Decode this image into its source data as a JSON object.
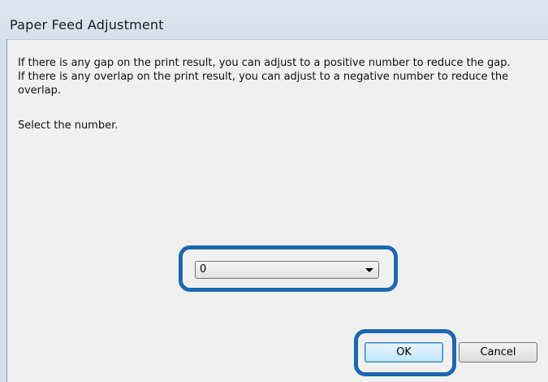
{
  "window": {
    "title": "Paper Feed Adjustment"
  },
  "dialog": {
    "message_line1": "If there is any gap on the print result, you can adjust to a positive number to reduce the gap.",
    "message_line2": "If there is any overlap on the print result, you can adjust to a negative number to reduce the overlap.",
    "prompt": "Select the number.",
    "adjustment_select": {
      "selected_value": "0"
    },
    "ok_label": "OK",
    "cancel_label": "Cancel"
  },
  "colors": {
    "highlight": "#1b67b3",
    "title_bar": "#d4e0ec"
  },
  "icons": {
    "dropdown": "chevron-down-icon"
  }
}
